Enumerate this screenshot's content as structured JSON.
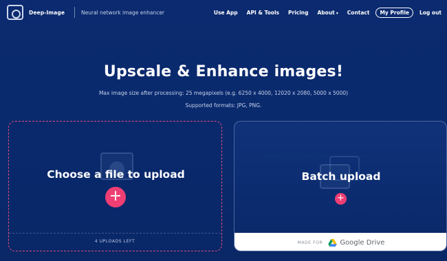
{
  "nav": {
    "brand": "Deep-Image",
    "tagline": "Neural network image enhancer",
    "links": [
      "Use App",
      "API & Tools",
      "Pricing",
      "About",
      "Contact"
    ],
    "profile": "My Profile",
    "logout": "Log out"
  },
  "hero": {
    "title": "Upscale & Enhance images!",
    "max_size": "Max image size after processing: 25 megapixels (e.g. 6250 x 4000, 12020 x 2080, 5000 x 5000)",
    "formats": "Supported formats: JPG, PNG."
  },
  "upload": {
    "title": "Choose a file to upload",
    "plus": "+",
    "uploads_left": "4 UPLOADS LEFT"
  },
  "batch": {
    "title": "Batch upload",
    "plus": "+",
    "made_for": "MADE FOR",
    "drive_label": "Google Drive"
  },
  "colors": {
    "background": "#0b2a6f",
    "accent_pink": "#ef3e73",
    "dashed_border": "#e64b7d"
  },
  "icons": {
    "logo": "eye-logo-icon",
    "caret": "chevron-down-icon",
    "plus": "plus-icon",
    "image_placeholder": "image-placeholder-icon",
    "drive": "google-drive-icon"
  }
}
